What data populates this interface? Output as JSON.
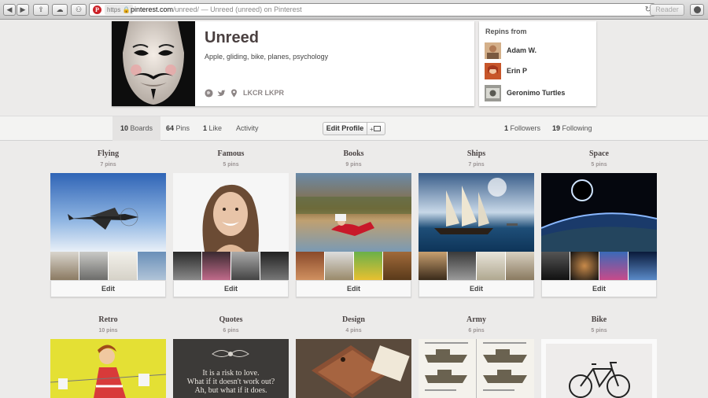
{
  "browser": {
    "protocol": "https",
    "domain": "pinterest.com",
    "path": "/unreed/",
    "separator": "—",
    "page_title": "Unreed (unreed) on Pinterest",
    "reader_label": "Reader"
  },
  "profile": {
    "name": "Unreed",
    "about": "Apple, gliding, bike, planes, psychology",
    "location": "LKCR LKPR"
  },
  "repins": {
    "title": "Repins from",
    "users": [
      "Adam W.",
      "Erin P",
      "Geronimo Turtles"
    ]
  },
  "stats": {
    "boards_count": "10",
    "boards_label": "Boards",
    "pins_count": "64",
    "pins_label": "Pins",
    "likes_count": "1",
    "likes_label": "Like",
    "activity_label": "Activity",
    "edit_profile_label": "Edit Profile",
    "followers_count": "1",
    "followers_label": "Followers",
    "following_count": "19",
    "following_label": "Following"
  },
  "boards": [
    {
      "title": "Flying",
      "pins": "7 pins",
      "edit": "Edit"
    },
    {
      "title": "Famous",
      "pins": "5 pins",
      "edit": "Edit"
    },
    {
      "title": "Books",
      "pins": "9 pins",
      "edit": "Edit"
    },
    {
      "title": "Ships",
      "pins": "7 pins",
      "edit": "Edit"
    },
    {
      "title": "Space",
      "pins": "5 pins",
      "edit": "Edit"
    },
    {
      "title": "Retro",
      "pins": "10 pins"
    },
    {
      "title": "Quotes",
      "pins": "6 pins"
    },
    {
      "title": "Design",
      "pins": "4 pins"
    },
    {
      "title": "Army",
      "pins": "6 pins"
    },
    {
      "title": "Bike",
      "pins": "5 pins"
    }
  ],
  "quote_text": [
    "It is a risk to love.",
    "What if it doesn't work out?",
    "Ah, but what if it does."
  ],
  "colors": {
    "brand": "#cb2027",
    "page_bg": "#ecebea",
    "card_bg": "#ffffff",
    "text": "#4a4040"
  },
  "icons": [
    "back-icon",
    "forward-icon",
    "share-icon",
    "cloud-icon",
    "network-icon",
    "pinterest-icon",
    "lock-icon",
    "reload-icon",
    "download-icon",
    "globe-icon",
    "twitter-icon",
    "location-pin-icon",
    "dashboard-toggle-icon"
  ]
}
